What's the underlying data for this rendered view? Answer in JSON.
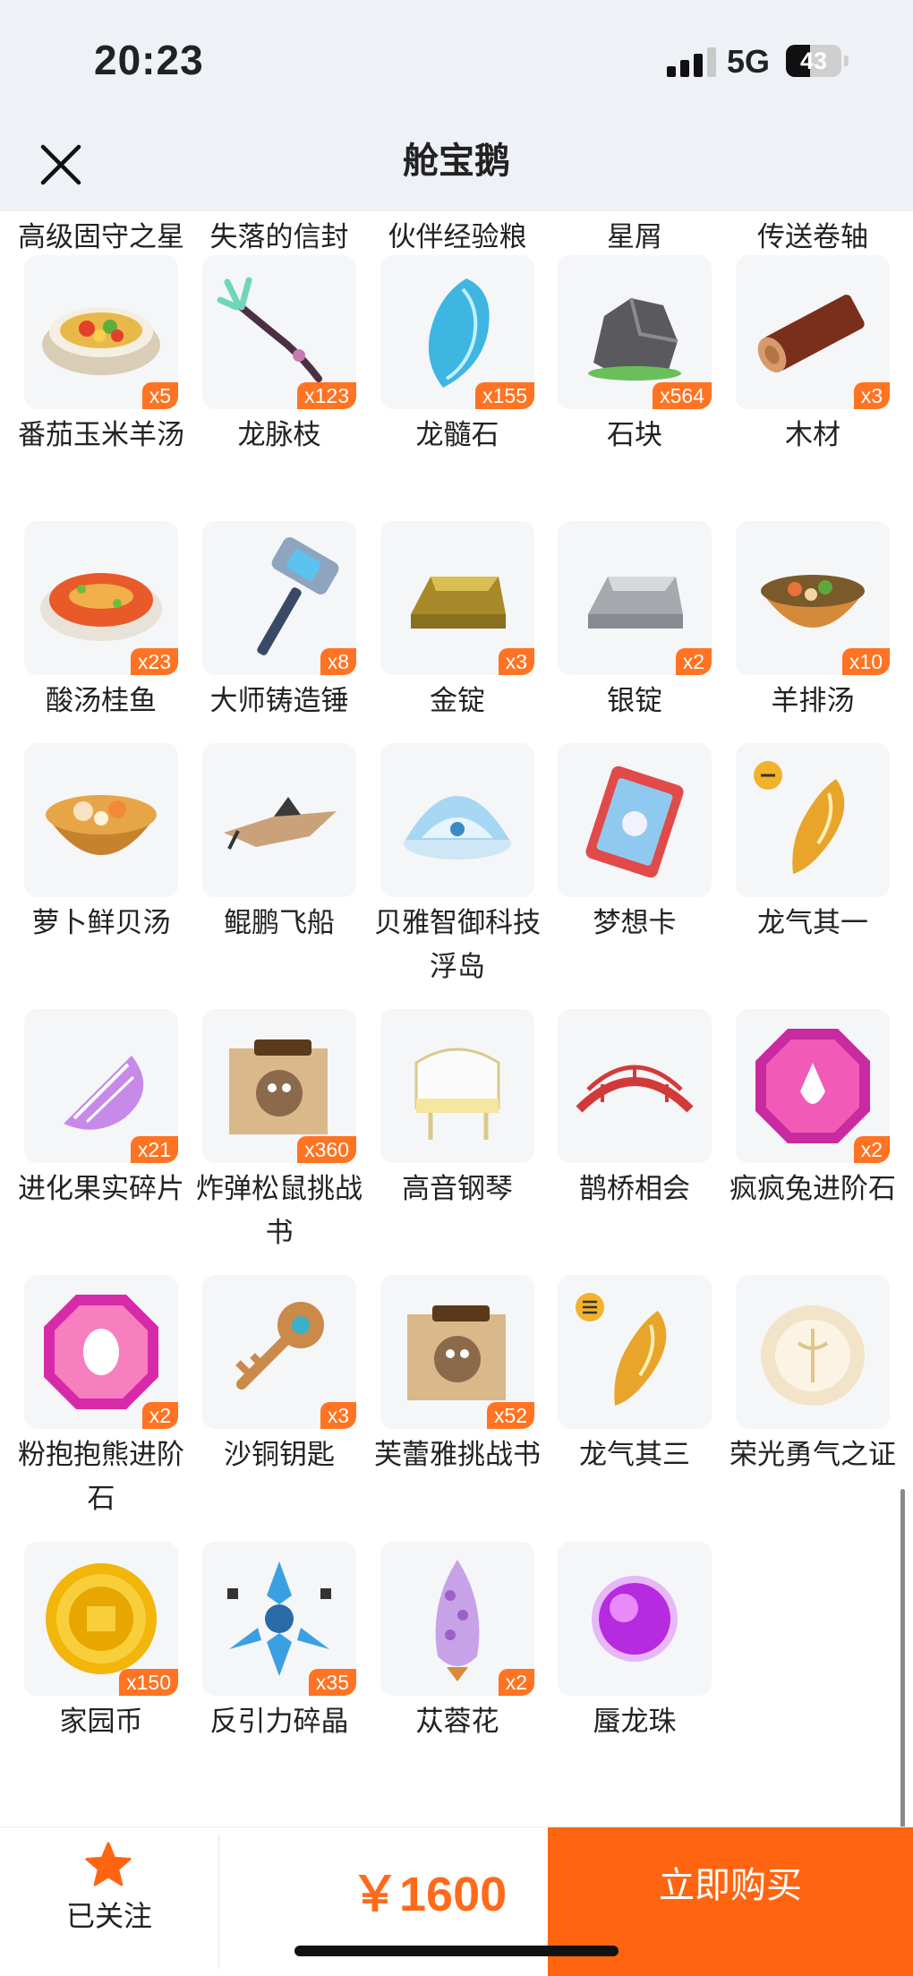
{
  "status_bar": {
    "time": "20:23",
    "network": "5G",
    "battery": "43",
    "battery_level": 0.43
  },
  "nav": {
    "title": "舱宝鹅",
    "close_icon": "close-icon"
  },
  "items": [
    {
      "name": "高级固守之星",
      "badge": "",
      "icon": "star-item-icon"
    },
    {
      "name": "失落的信封",
      "badge": "",
      "icon": "envelope-icon"
    },
    {
      "name": "伙伴经验粮",
      "badge": "",
      "icon": "exp-food-icon"
    },
    {
      "name": "星屑",
      "badge": "",
      "icon": "stardust-icon"
    },
    {
      "name": "传送卷轴",
      "badge": "",
      "icon": "scroll-icon"
    },
    {
      "name": "番茄玉米羊汤",
      "badge": "x5",
      "icon": "soup-bowl-icon"
    },
    {
      "name": "龙脉枝",
      "badge": "x123",
      "icon": "dragon-branch-icon"
    },
    {
      "name": "龙髓石",
      "badge": "x155",
      "icon": "crystal-icon"
    },
    {
      "name": "石块",
      "badge": "x564",
      "icon": "rock-icon"
    },
    {
      "name": "木材",
      "badge": "x3",
      "icon": "log-icon"
    },
    {
      "name": "酸汤桂鱼",
      "badge": "x23",
      "icon": "fish-dish-icon"
    },
    {
      "name": "大师铸造锤",
      "badge": "x8",
      "icon": "hammer-icon"
    },
    {
      "name": "金锭",
      "badge": "x3",
      "icon": "gold-ingot-icon"
    },
    {
      "name": "银锭",
      "badge": "x2",
      "icon": "silver-ingot-icon"
    },
    {
      "name": "羊排汤",
      "badge": "x10",
      "icon": "stew-icon"
    },
    {
      "name": "萝卜鲜贝汤",
      "badge": "",
      "icon": "scallop-soup-icon"
    },
    {
      "name": "鲲鹏飞船",
      "badge": "",
      "icon": "airship-icon"
    },
    {
      "name": "贝雅智御科技浮岛",
      "badge": "",
      "icon": "floating-island-icon"
    },
    {
      "name": "梦想卡",
      "badge": "",
      "icon": "dream-card-icon"
    },
    {
      "name": "龙气其一",
      "badge": "",
      "icon": "dragon-qi-one-icon"
    },
    {
      "name": "进化果实碎片",
      "badge": "x21",
      "icon": "fruit-shard-icon"
    },
    {
      "name": "炸弹松鼠挑战书",
      "badge": "x360",
      "icon": "wanted-poster-icon"
    },
    {
      "name": "高音钢琴",
      "badge": "",
      "icon": "piano-icon"
    },
    {
      "name": "鹊桥相会",
      "badge": "",
      "icon": "bridge-icon"
    },
    {
      "name": "疯疯兔进阶石",
      "badge": "x2",
      "icon": "rabbit-gem-icon"
    },
    {
      "name": "粉抱抱熊进阶石",
      "badge": "x2",
      "icon": "bear-gem-icon"
    },
    {
      "name": "沙铜钥匙",
      "badge": "x3",
      "icon": "key-icon"
    },
    {
      "name": "芙蕾雅挑战书",
      "badge": "x52",
      "icon": "wanted-poster-icon"
    },
    {
      "name": "龙气其三",
      "badge": "",
      "icon": "dragon-qi-three-icon"
    },
    {
      "name": "荣光勇气之证",
      "badge": "",
      "icon": "emblem-icon"
    },
    {
      "name": "家园币",
      "badge": "x150",
      "icon": "coin-icon"
    },
    {
      "name": "反引力碎晶",
      "badge": "x35",
      "icon": "antigravity-shard-icon"
    },
    {
      "name": "苁蓉花",
      "badge": "x2",
      "icon": "flower-icon"
    },
    {
      "name": "蜃龙珠",
      "badge": "",
      "icon": "purple-orb-icon"
    }
  ],
  "bottom_bar": {
    "follow_label": "已关注",
    "price": "￥1600",
    "buy_label": "立即购买"
  },
  "colors": {
    "accent": "#ff6511",
    "badge": "#ff7322",
    "nav_bg": "#eef1f5"
  }
}
